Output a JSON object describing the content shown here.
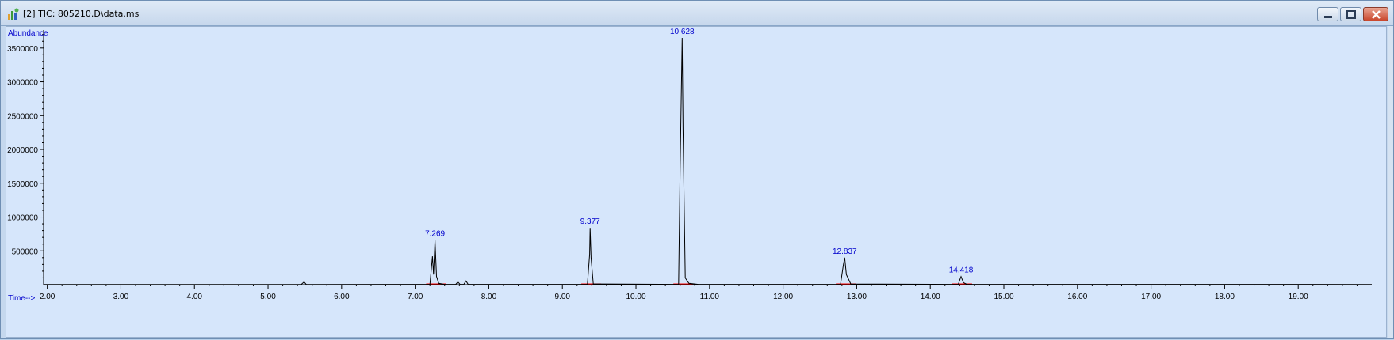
{
  "window": {
    "title": "[2] TIC: 805210.D\\data.ms",
    "icon": "chromatogram-icon",
    "controls": [
      "minimize-icon",
      "restore-icon",
      "close-icon"
    ]
  },
  "chart_data": {
    "type": "line",
    "ylabel": "Abundance",
    "xlabel": "Time-->",
    "xlim": [
      1.95,
      20.0
    ],
    "ylim": [
      0,
      3720000
    ],
    "x_ticks": [
      "2.00",
      "3.00",
      "4.00",
      "5.00",
      "6.00",
      "7.00",
      "8.00",
      "9.00",
      "10.00",
      "11.00",
      "12.00",
      "13.00",
      "14.00",
      "15.00",
      "16.00",
      "17.00",
      "18.00",
      "19.00"
    ],
    "y_ticks": [
      "500000",
      "1000000",
      "1500000",
      "2000000",
      "2500000",
      "3000000",
      "3500000"
    ],
    "grid": false,
    "colors": {
      "trace": "#000000",
      "labels": "#0000cc",
      "baseline": "#ff0000",
      "background": "#d6e6fb"
    },
    "series": [
      {
        "values": [
          [
            1.95,
            3000
          ],
          [
            5.45,
            3000
          ],
          [
            5.49,
            40000
          ],
          [
            5.52,
            3000
          ],
          [
            7.2,
            5000
          ],
          [
            7.235,
            420000
          ],
          [
            7.25,
            150000
          ],
          [
            7.269,
            660000
          ],
          [
            7.29,
            120000
          ],
          [
            7.32,
            20000
          ],
          [
            7.4,
            5000
          ],
          [
            7.55,
            5000
          ],
          [
            7.58,
            40000
          ],
          [
            7.61,
            5000
          ],
          [
            7.66,
            5000
          ],
          [
            7.69,
            55000
          ],
          [
            7.72,
            5000
          ],
          [
            9.34,
            5000
          ],
          [
            9.37,
            450000
          ],
          [
            9.377,
            840000
          ],
          [
            9.39,
            400000
          ],
          [
            9.42,
            10000
          ],
          [
            10.58,
            5000
          ],
          [
            10.6,
            1700000
          ],
          [
            10.628,
            3650000
          ],
          [
            10.64,
            2300000
          ],
          [
            10.67,
            100000
          ],
          [
            10.72,
            20000
          ],
          [
            10.85,
            5000
          ],
          [
            12.78,
            5000
          ],
          [
            12.82,
            300000
          ],
          [
            12.837,
            400000
          ],
          [
            12.86,
            150000
          ],
          [
            12.92,
            10000
          ],
          [
            14.38,
            5000
          ],
          [
            14.41,
            100000
          ],
          [
            14.418,
            120000
          ],
          [
            14.45,
            30000
          ],
          [
            14.5,
            5000
          ],
          [
            20.0,
            3000
          ]
        ]
      }
    ],
    "peak_labels": [
      {
        "x": 7.269,
        "y": 660000,
        "label": "7.269"
      },
      {
        "x": 9.377,
        "y": 840000,
        "label": "9.377"
      },
      {
        "x": 10.628,
        "y": 3650000,
        "label": "10.628"
      },
      {
        "x": 12.837,
        "y": 400000,
        "label": "12.837"
      },
      {
        "x": 14.418,
        "y": 120000,
        "label": "14.418"
      }
    ]
  }
}
